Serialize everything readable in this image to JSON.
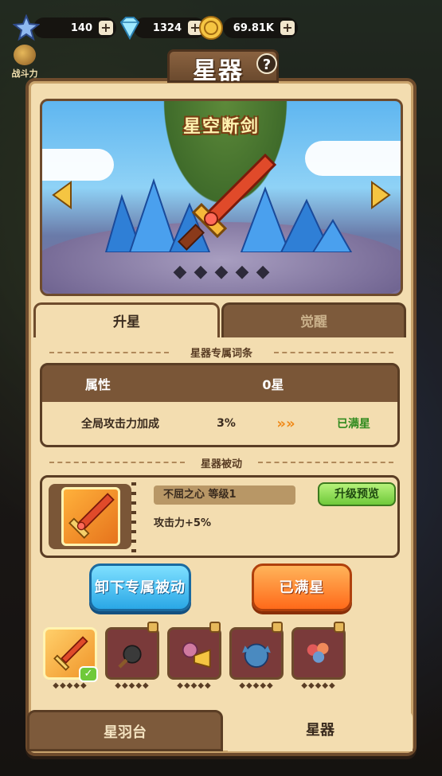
{
  "currencies": [
    {
      "icon": "star-icon",
      "value": "140"
    },
    {
      "icon": "diamond-icon",
      "value": "1324"
    },
    {
      "icon": "gold-coin-icon",
      "value": "69.81K"
    }
  ],
  "background": {
    "left_tag": "战斗力"
  },
  "panel": {
    "title": "星器"
  },
  "hero": {
    "item_name": "星空断剑",
    "stars": [
      "◆",
      "◆",
      "◆",
      "◆",
      "◆"
    ]
  },
  "tabs": {
    "upgrade_star": "升星",
    "awaken": "觉醒"
  },
  "exclusive_section": {
    "title": "星器专属词条",
    "header": {
      "attribute": "属性",
      "star": "0星"
    },
    "row": {
      "name": "全局攻击力加成",
      "value": "3%",
      "arrows": "»»",
      "status": "已满星"
    }
  },
  "passive_section": {
    "title": "星器被动",
    "skill_name": "不屈之心 等级1",
    "description": "攻击力+5%",
    "preview_button": "升级预览"
  },
  "buttons": {
    "unequip": "卸下专属被动",
    "maxed": "已满星"
  },
  "slots": [
    {
      "name": "sword",
      "selected": true,
      "locked": false,
      "stars": "◆◆◆◆◆"
    },
    {
      "name": "spiked-mace",
      "selected": false,
      "locked": true,
      "stars": "◆◆◆◆◆"
    },
    {
      "name": "trumpet",
      "selected": false,
      "locked": true,
      "stars": "◆◆◆◆◆"
    },
    {
      "name": "spiky-creature",
      "selected": false,
      "locked": true,
      "stars": "◆◆◆◆◆"
    },
    {
      "name": "bouquet",
      "selected": false,
      "locked": true,
      "stars": "◆◆◆◆◆"
    }
  ],
  "bottom_tabs": {
    "platform": "星羽台",
    "star_item": "星器"
  },
  "colors": {
    "panel": "#f3ddb0",
    "border": "#6e4b2c",
    "maxed_green": "#2f8a1e",
    "blue_button": "#2aa7e6",
    "orange_button": "#ff6a1a"
  }
}
